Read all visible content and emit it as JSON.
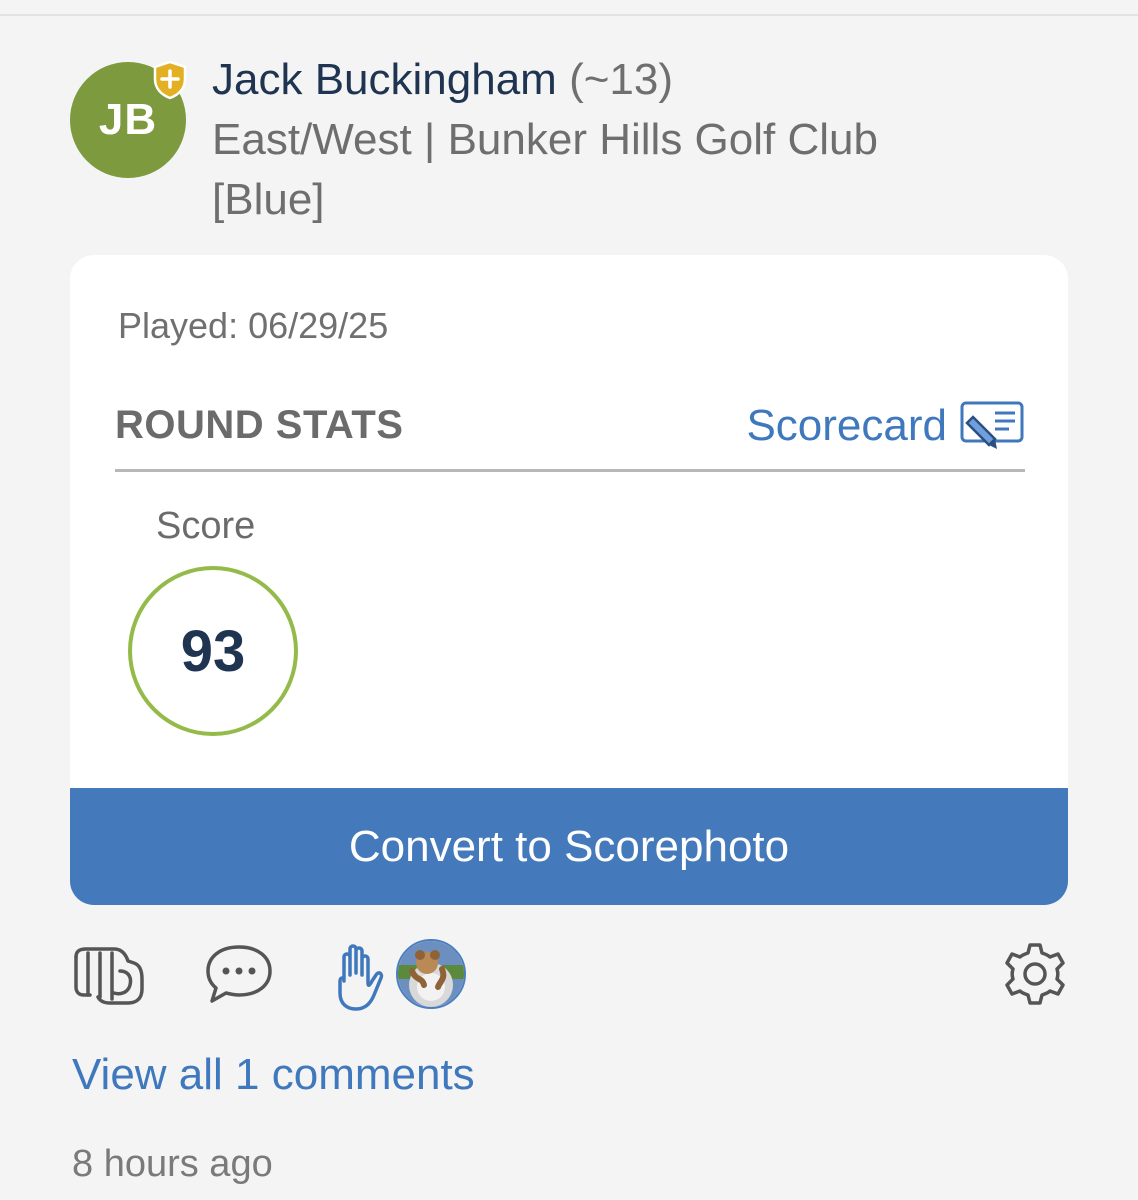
{
  "post": {
    "avatar_initials": "JB",
    "player_name": "Jack Buckingham",
    "handicap": "(~13)",
    "course_line1": "East/West | Bunker Hills Golf Club",
    "course_line2": "[Blue]"
  },
  "card": {
    "played": "Played: 06/29/25",
    "section_title": "ROUND STATS",
    "scorecard_link": "Scorecard",
    "score_label": "Score",
    "score_value": "93",
    "convert_button": "Convert to Scorephoto"
  },
  "footer": {
    "view_comments": "View all 1 comments",
    "timestamp": "8 hours ago"
  },
  "icons": [
    "shield-plus-icon",
    "scorecard-edit-icon",
    "fist-bump-icon",
    "comment-icon",
    "raised-hand-icon",
    "gear-icon"
  ],
  "colors": {
    "accent_blue": "#4479bc",
    "avatar_green": "#7e9a3e",
    "score_ring": "#94bb4a",
    "name_navy": "#1f3450",
    "shield_gold": "#e2b022"
  }
}
